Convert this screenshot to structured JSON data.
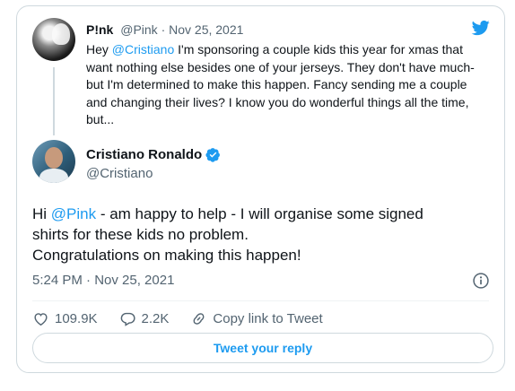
{
  "quoted": {
    "name": "P!nk",
    "meta": "@Pink · Nov 25, 2021",
    "text_lines": [
      [
        "Hey ",
        "@Cristiano",
        " I'm sponsoring a couple kids this year for xmas that"
      ],
      [
        "want nothing else besides one of your jerseys. They don't have much-"
      ],
      [
        "but I'm determined to make this happen. Fancy sending me a couple"
      ],
      [
        "and changing their lives? I know you do wonderful things all the time,"
      ],
      [
        "but..."
      ]
    ]
  },
  "tweet": {
    "name": "Cristiano Ronaldo",
    "handle": "@Cristiano",
    "text_pre": "Hi ",
    "mention": "@Pink",
    "text_line1_post": " - am happy to help - I will organise some signed",
    "text_line2": "shirts for these kids no problem.",
    "text_line3": "Congratulations on making this happen!",
    "timestamp": "5:24 PM · Nov 25, 2021"
  },
  "actions": {
    "likes": "109.9K",
    "replies": "2.2K",
    "copy_link": "Copy link to Tweet"
  },
  "reply_button": "Tweet your reply",
  "colors": {
    "accent": "#1d9bf0",
    "text": "#0f1419",
    "secondary": "#536471",
    "border": "#cfd9de"
  },
  "icons": [
    "twitter-bird-icon",
    "verified-badge-icon",
    "info-icon",
    "heart-icon",
    "reply-icon",
    "link-icon"
  ]
}
